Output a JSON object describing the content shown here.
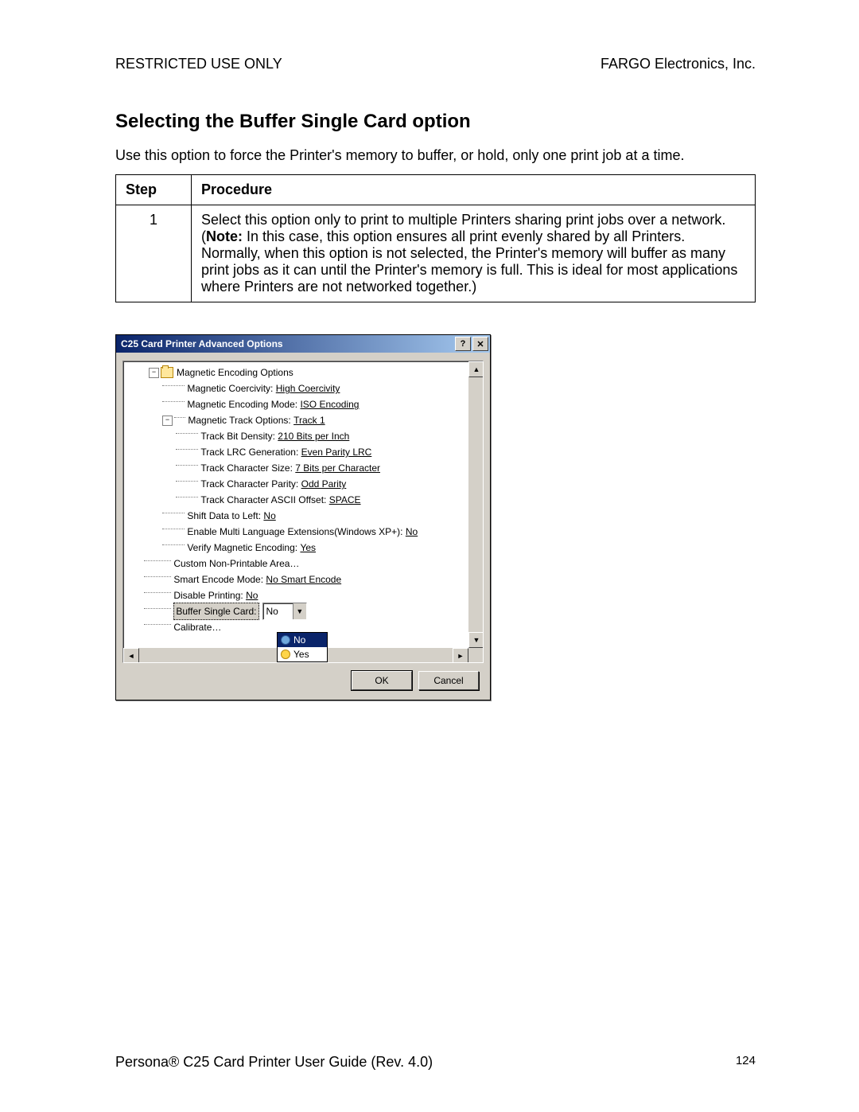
{
  "header": {
    "left": "RESTRICTED USE ONLY",
    "right": "FARGO Electronics, Inc."
  },
  "title": "Selecting the Buffer Single Card option",
  "intro": "Use this option to force the Printer's memory to buffer, or hold, only one print job at a time.",
  "table": {
    "h1": "Step",
    "h2": "Procedure",
    "step": "1",
    "proc_a": "Select this option only to print to multiple Printers sharing print jobs over a network.  (",
    "proc_note": "Note:",
    "proc_b": "  In this case, this option ensures all print evenly shared by all Printers.  Normally, when this option is not selected, the Printer's memory will buffer as many print jobs as it can until the Printer's memory is full.  This is ideal for most applications where Printers are not networked together.)"
  },
  "dialog": {
    "title": "C25 Card Printer Advanced Options",
    "tree": {
      "root": "Magnetic Encoding Options",
      "items": [
        {
          "label": "Magnetic Coercivity:",
          "value": "High Coercivity"
        },
        {
          "label": "Magnetic Encoding Mode:",
          "value": "ISO Encoding"
        },
        {
          "label": "Magnetic Track Options:",
          "value": "Track 1",
          "sub": [
            {
              "label": "Track Bit Density:",
              "value": "210 Bits per Inch"
            },
            {
              "label": "Track LRC Generation:",
              "value": "Even Parity LRC"
            },
            {
              "label": "Track Character Size:",
              "value": "7 Bits per Character"
            },
            {
              "label": "Track Character Parity:",
              "value": "Odd Parity"
            },
            {
              "label": "Track Character ASCII Offset:",
              "value": "SPACE"
            }
          ]
        },
        {
          "label": "Shift Data to Left:",
          "value": "No"
        },
        {
          "label": "Enable Multi Language Extensions(Windows XP+):",
          "value": "No"
        },
        {
          "label": "Verify Magnetic Encoding:",
          "value": "Yes"
        }
      ],
      "level0": [
        {
          "label": "Custom Non-Printable Area…",
          "value": ""
        },
        {
          "label": "Smart Encode Mode:",
          "value": "No Smart Encode"
        },
        {
          "label": "Disable Printing:",
          "value": "No"
        },
        {
          "label": "Buffer Single Card:",
          "value": "No",
          "selected": true
        },
        {
          "label": "Calibrate…",
          "value": ""
        }
      ],
      "combo_value": "No",
      "dropdown": {
        "opt1": "No",
        "opt2": "Yes"
      }
    },
    "ok": "OK",
    "cancel": "Cancel"
  },
  "footer": {
    "left": "Persona® C25 Card Printer User Guide (Rev. 4.0)",
    "page": "124"
  }
}
